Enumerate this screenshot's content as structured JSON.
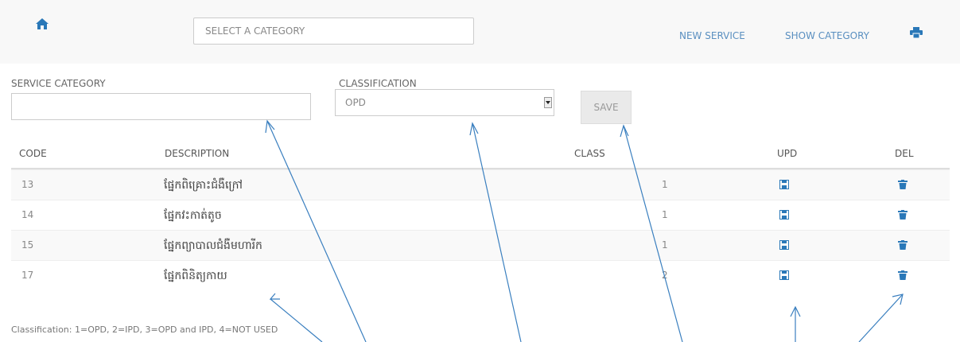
{
  "topbar": {
    "category_select": "SELECT A CATEGORY",
    "new_service": "NEW SERVICE",
    "show_category": "SHOW CATEGORY"
  },
  "form": {
    "service_category_label": "SERVICE CATEGORY",
    "service_category_value": "",
    "classification_label": "CLASSIFICATION",
    "classification_value": "OPD",
    "save_label": "SAVE"
  },
  "table": {
    "headers": {
      "code": "CODE",
      "description": "DESCRIPTION",
      "class": "CLASS",
      "upd": "UPD",
      "del": "DEL"
    },
    "rows": [
      {
        "code": "13",
        "description": "ផ្នែកពិគ្រោះជំងឺក្រៅ",
        "class": "1"
      },
      {
        "code": "14",
        "description": "ផ្នែកវះកាត់តូច",
        "class": "1"
      },
      {
        "code": "15",
        "description": "ផ្នែកព្យាបាលជំងឺមហារីក",
        "class": "1"
      },
      {
        "code": "17",
        "description": "ផ្នែកពិនិត្យកាយ",
        "class": "2"
      }
    ]
  },
  "footer_note": "Classification: 1=OPD, 2=IPD, 3=OPD and IPD, 4=NOT USED",
  "colors": {
    "link": "#5a8fc0",
    "icon": "#2a78b8",
    "arrow": "#3a7fbf"
  }
}
